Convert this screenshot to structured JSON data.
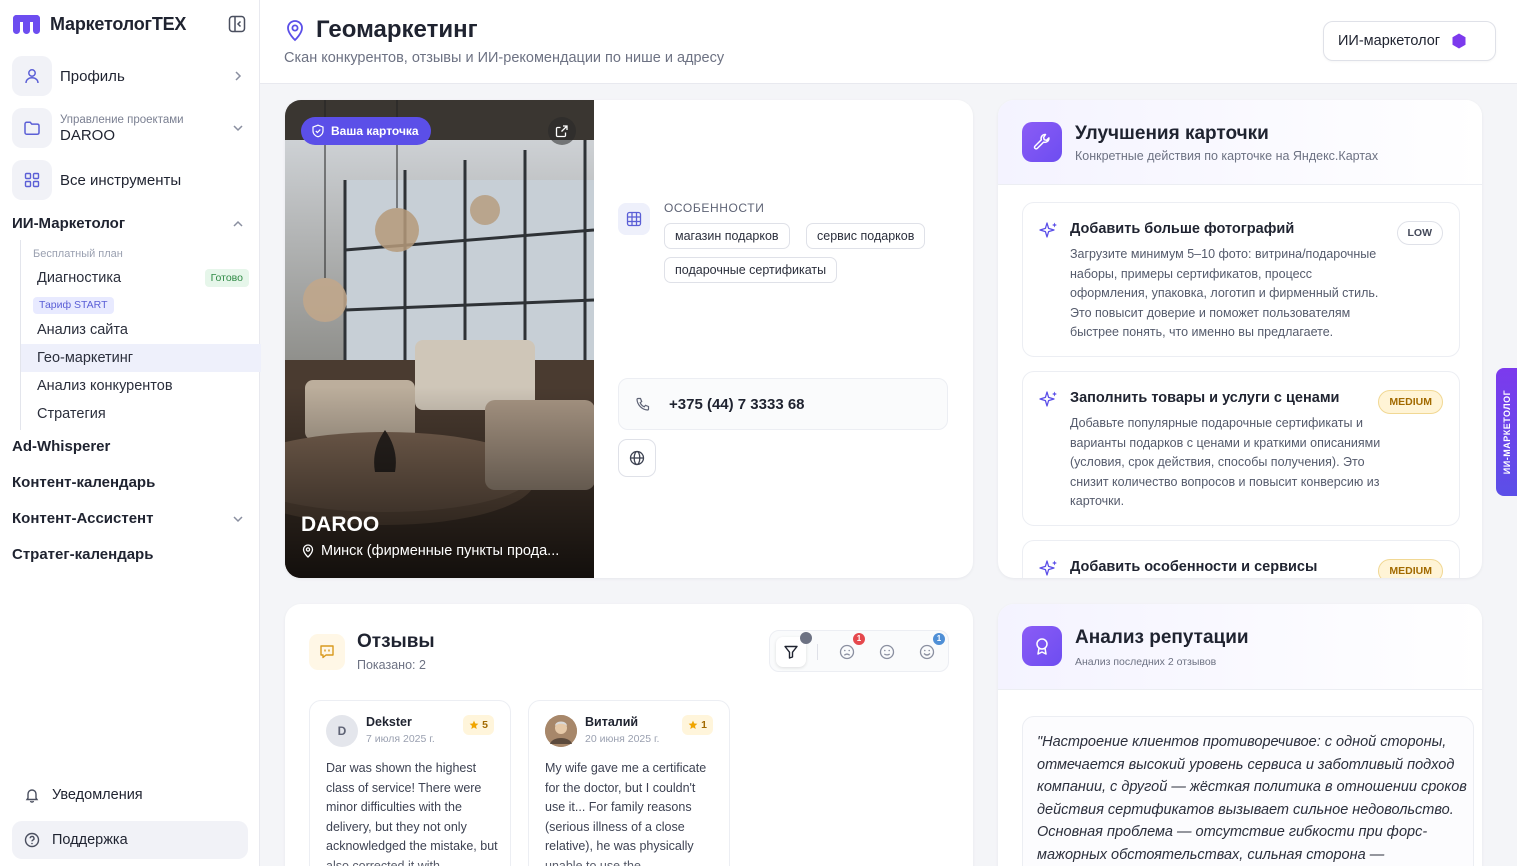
{
  "app": {
    "brand": "МаркетологТЕХ",
    "accent": "#5b4fe8"
  },
  "sidebar": {
    "profile_label": "Профиль",
    "project_sublabel": "Управление проектами",
    "project_name": "DAROO",
    "all_tools_label": "Все инструменты",
    "sections": {
      "ai_marketer": "ИИ-Маркетолог",
      "ad_whisperer": "Ad-Whisperer",
      "content_calendar": "Контент-календарь",
      "content_assistant": "Контент-Ассистент",
      "strategy_calendar": "Стратег-календарь"
    },
    "free_plan_label": "Бесплатный план",
    "tarif_badge": "Тариф START",
    "ready_badge": "Готово",
    "items": [
      {
        "label": "Диагностика"
      },
      {
        "label": "Анализ сайта"
      },
      {
        "label": "Гео-маркетинг"
      },
      {
        "label": "Анализ конкурентов"
      },
      {
        "label": "Стратегия"
      }
    ],
    "notifications_label": "Уведомления",
    "support_label": "Поддержка"
  },
  "header": {
    "title": "Геомаркетинг",
    "subtitle": "Скан конкурентов, отзывы и ИИ-рекомендации по нише и адресу",
    "ai_button_label": "ИИ-маркетолог"
  },
  "business": {
    "badge": "Ваша карточка",
    "name": "DAROO",
    "address": "Минск (фирменные пункты прода...",
    "features_title": "ОСОБЕННОСТИ",
    "features": [
      "магазин подарков",
      "сервис подарков",
      "подарочные сертификаты"
    ],
    "phone": "+375 (44) 7 3333 68"
  },
  "improvements": {
    "title": "Улучшения карточки",
    "subtitle": "Конкретные действия по карточке на Яндекс.Картах",
    "items": [
      {
        "title": "Добавить больше фотографий",
        "priority": "LOW",
        "body": "Загрузите минимум 5–10 фото: витрина/подарочные наборы, примеры сертификатов, процесс оформления, упаковка, логотип и фирменный стиль. Это повысит доверие и поможет пользователям быстрее понять, что именно вы предлагаете."
      },
      {
        "title": "Заполнить товары и услуги с ценами",
        "priority": "MEDIUM",
        "body": "Добавьте популярные подарочные сертификаты и варианты подарков с ценами и краткими описаниями (условия, срок действия, способы получения). Это снизит количество вопросов и повысит конверсию из карточки."
      },
      {
        "title": "Добавить особенности и сервисы",
        "priority": "MEDIUM",
        "body": ""
      }
    ]
  },
  "reviews": {
    "title": "Отзывы",
    "shown": "Показано: 2",
    "filter_counts": {
      "negative": "1",
      "positive": "1"
    },
    "items": [
      {
        "initial": "D",
        "author": "Dekster",
        "date": "7 июля 2025 г.",
        "rating": "5",
        "text": "Dar was shown the highest class of service! There were minor difficulties with the delivery, but they not only acknowledged the mistake, but also corrected it with..."
      },
      {
        "initial": "",
        "author": "Виталий",
        "date": "20 июня 2025 г.",
        "rating": "1",
        "text": "My wife gave me a certificate for the doctor, but I couldn't use it... For family reasons (serious illness of a close relative), he was physically unable to use the..."
      }
    ]
  },
  "reputation": {
    "title": "Анализ репутации",
    "subtitle": "Анализ последних 2 отзывов",
    "quote": "\"Настроение клиентов противоречивое: с одной стороны, отмечается высокий уровень сервиса и заботливый подход компании, с другой — жёсткая политика в отношении сроков действия сертификатов вызывает сильное недовольство. Основная проблема — отсутствие гибкости при форс-мажорных обстоятельствах, сильная сторона —"
  },
  "side_tab": {
    "label": "ИИ-МАРКЕТОЛОГ"
  }
}
